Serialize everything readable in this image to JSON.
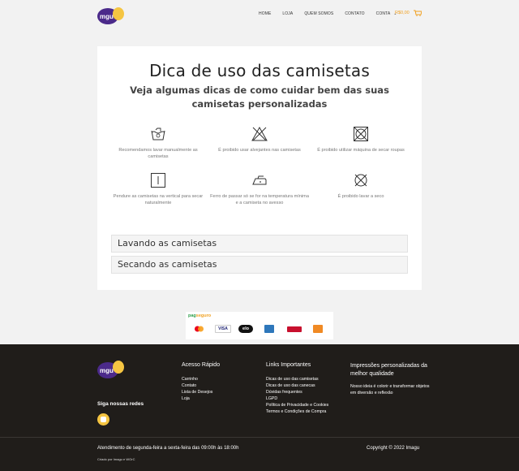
{
  "header": {
    "nav": [
      "HOME",
      "LOJA",
      "QUEM SOMOS",
      "CONTATO",
      "CONTA"
    ],
    "cart_amount": "R$0,00",
    "brand_colors": {
      "purple": "#4b2a8a",
      "yellow": "#f5c542",
      "orange": "#f0a020"
    }
  },
  "main": {
    "title": "Dica de uso das camisetas",
    "subtitle": "Veja algumas dicas de como cuidar bem das suas camisetas personalizadas",
    "tips": [
      {
        "icon": "hand-wash-icon",
        "text": "Recomendamos lavar manualmente as camisetas"
      },
      {
        "icon": "no-bleach-icon",
        "text": "É proibido usar alvejantes nas camisetas"
      },
      {
        "icon": "no-machine-dry-icon",
        "text": "É proibido utilizar máquina de secar roupas"
      },
      {
        "icon": "line-dry-icon",
        "text": "Pendure as camisetas na vertical para secar naturalmente"
      },
      {
        "icon": "iron-low-icon",
        "text": "Ferro de passar só se for na temperatura mínima e a camiseta no avesso"
      },
      {
        "icon": "no-dry-clean-icon",
        "text": "É proibido lavar a seco"
      }
    ],
    "accordions": [
      "Lavando as camisetas",
      "Secando as camisetas"
    ]
  },
  "payment": {
    "logo_left": "pag",
    "logo_right": "seguro",
    "methods": [
      "mastercard",
      "VISA",
      "elo",
      "amex",
      "hipercard",
      "boleto"
    ]
  },
  "footer": {
    "follow_label": "Siga nossas redes",
    "quick_title": "Acesso Rápido",
    "quick_links": [
      "Carrinho",
      "Contato",
      "Lista de Desejos",
      "Loja"
    ],
    "important_title": "Links Importantes",
    "important_links": [
      "Dicas de uso das camisetas",
      "Dicas de uso das canecas",
      "Dúvidas frequentes",
      "LGPD",
      "Política de Privacidade e Cookies",
      "Termos e Condições de Compra"
    ],
    "about_title": "Impressões personalizadas da melhor qualidade",
    "about_text": "Nosso ideia é colorir e transformar objetos em diversão e reflexão",
    "hours": "Atendimento de segunda-feira a sexta-feira das 09:00h às 18:00h",
    "copyright": "Copyright © 2022 Imagu",
    "credit": "Criado por Imagu e WOrC"
  }
}
